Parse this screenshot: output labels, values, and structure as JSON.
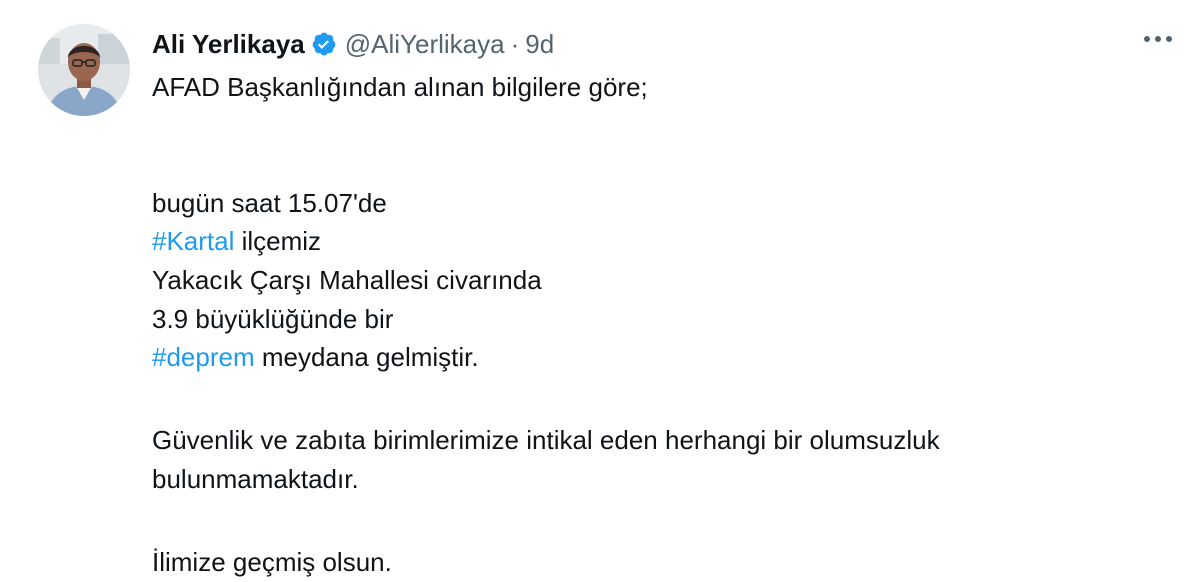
{
  "author": {
    "name": "Ali Yerlikaya",
    "handle": "@AliYerlikaya",
    "separator": "·",
    "time": "9d",
    "verified_icon": "verified-badge-icon",
    "avatar_icon": "profile-photo"
  },
  "tweet": {
    "line1": "AFAD Başkanlığından alınan bilgilere göre;",
    "line2": "bugün saat 15.07'de",
    "hashtag1": "#Kartal",
    "line3_rest": " ilçemiz",
    "line4": "Yakacık Çarşı Mahallesi civarında",
    "line5": "3.9 büyüklüğünde bir",
    "hashtag2": "#deprem",
    "line6_rest": " meydana gelmiştir.",
    "line7": "Güvenlik ve zabıta birimlerimize intikal eden herhangi bir olumsuzluk",
    "line8": "bulunmamaktadır.",
    "line9": "İlimize geçmiş olsun."
  },
  "colors": {
    "text": "#0f1419",
    "muted": "#536471",
    "link": "#1d9bf0"
  }
}
